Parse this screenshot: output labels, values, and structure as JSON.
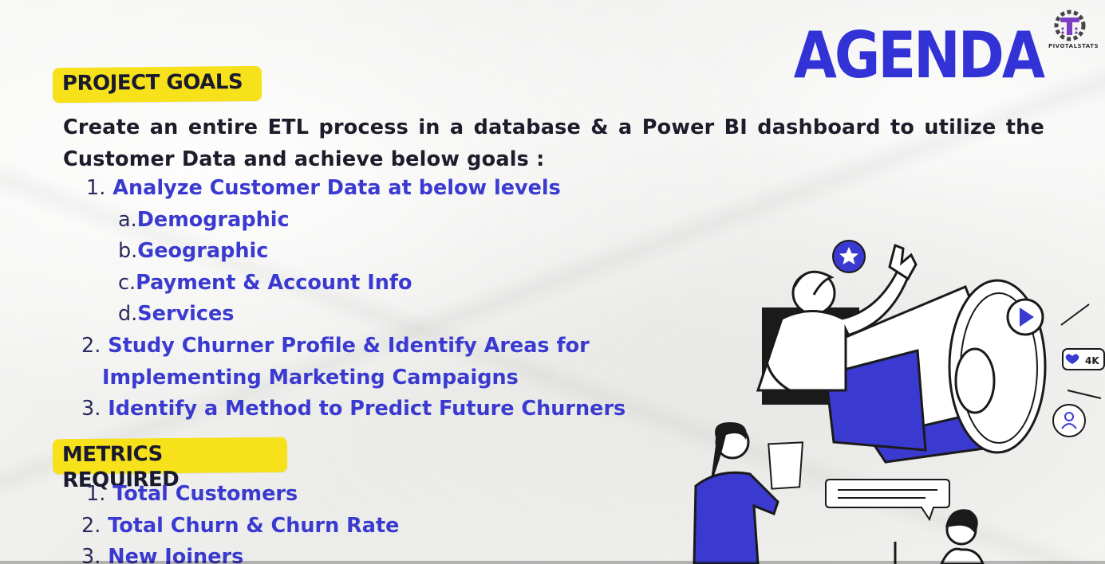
{
  "header": {
    "title": "AGENDA",
    "logo_text": "PIVOTALSTATS"
  },
  "project_goals": {
    "tag": "PROJECT GOALS",
    "intro": "Create an entire ETL process in a database & a Power BI dashboard to utilize the Customer Data and achieve below goals :",
    "items": [
      {
        "num": "1.",
        "text": "Analyze Customer Data at below levels",
        "subitems": [
          {
            "num": "a.",
            "text": "Demographic"
          },
          {
            "num": "b.",
            "text": "Geographic"
          },
          {
            "num": "c.",
            "text": "Payment & Account Info"
          },
          {
            "num": "d.",
            "text": "Services"
          }
        ]
      },
      {
        "num": "2.",
        "text_line1": "Study Churner Profile & Identify Areas for",
        "text_line2": "Implementing Marketing Campaigns"
      },
      {
        "num": "3.",
        "text": "Identify a Method to Predict Future Churners"
      }
    ]
  },
  "metrics_required": {
    "tag": "METRICS REQUIRED",
    "items": [
      {
        "num": "1.",
        "text": "Total Customers"
      },
      {
        "num": "2.",
        "text": "Total Churn & Churn Rate"
      },
      {
        "num": "3.",
        "text": "New Joiners"
      }
    ]
  },
  "illustration": {
    "likes_badge": "4K",
    "icons": [
      "star-icon",
      "play-icon",
      "heart-icon",
      "user-icon"
    ]
  },
  "colors": {
    "accent_blue": "#3a3ad0",
    "title_blue": "#3232d6",
    "tag_yellow": "#f6e11b",
    "text_dark": "#1c1c2b"
  }
}
